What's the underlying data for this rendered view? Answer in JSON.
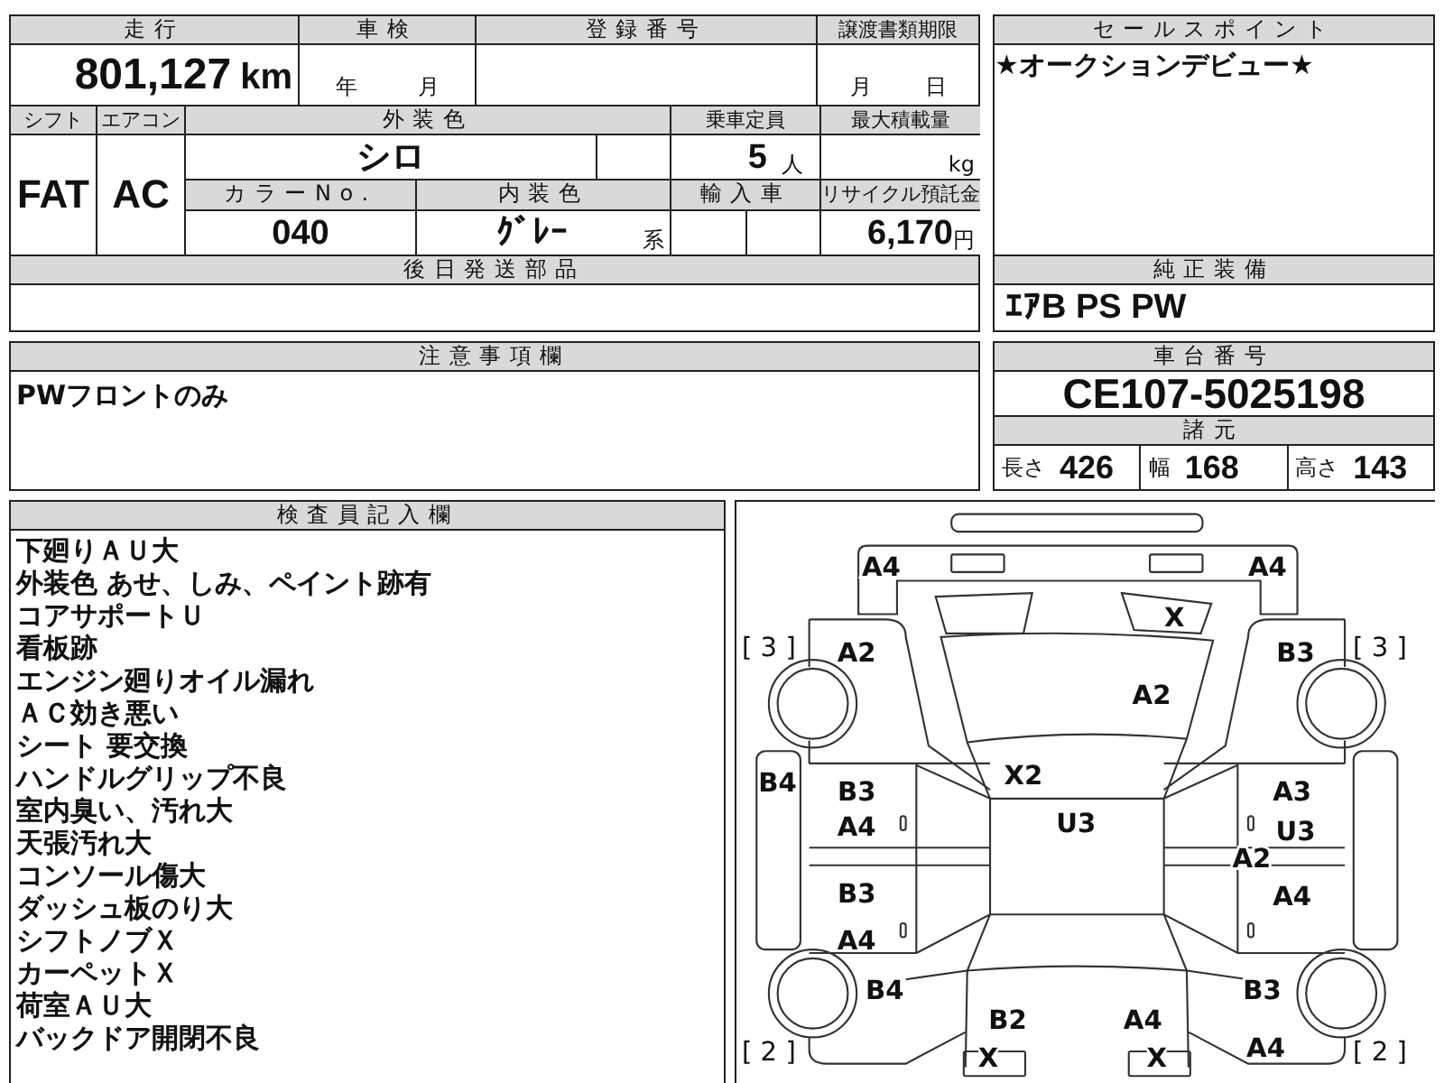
{
  "vehicle_table": {
    "mileage": {
      "header": "走行",
      "value": "801,127",
      "unit": "km"
    },
    "inspection": {
      "header": "車検",
      "year_unit": "年",
      "month_unit": "月"
    },
    "registration": {
      "header": "登録番号"
    },
    "transfer_deadline": {
      "header": "譲渡書類期限",
      "month_unit": "月",
      "day_unit": "日"
    },
    "shift": {
      "header": "シフト",
      "value": "FAT"
    },
    "aircon": {
      "header": "エアコン",
      "value": "AC"
    },
    "exterior_color": {
      "header": "外装色",
      "value": "シロ"
    },
    "capacity": {
      "header": "乗車定員",
      "value": "5",
      "unit": "人"
    },
    "max_load": {
      "header": "最大積載量",
      "unit": "kg"
    },
    "color_no": {
      "header": "カラーNo.",
      "value": "040"
    },
    "interior_color": {
      "header": "内装色",
      "value": "ｸﾞﾚｰ",
      "suffix": "系"
    },
    "imported": {
      "header": "輸入車"
    },
    "recycle_fee": {
      "header": "リサイクル預託金",
      "value": "6,170",
      "unit": "円"
    },
    "later_parts": {
      "header": "後日発送部品"
    }
  },
  "sales_point": {
    "header": "セールスポイント",
    "text": "★オークションデビュー★"
  },
  "standard_equipment": {
    "header": "純正装備",
    "text": "ｴｱB PS PW"
  },
  "notes": {
    "header": "注意事項欄",
    "text": "PWフロントのみ"
  },
  "chassis": {
    "header": "車台番号",
    "value": "CE107-5025198"
  },
  "specs": {
    "header": "諸元",
    "items": [
      {
        "label": "長さ",
        "value": "426"
      },
      {
        "label": "幅",
        "value": "168"
      },
      {
        "label": "高さ",
        "value": "143"
      }
    ]
  },
  "inspector_notes": {
    "header": "検査員記入欄",
    "lines": [
      "下廻りＡＵ大",
      "外装色 あせ、しみ、ペイント跡有",
      "コアサポートＵ",
      "看板跡",
      "エンジン廻りオイル漏れ",
      "ＡＣ効き悪い",
      "シート 要交換",
      "ハンドルグリップ不良",
      "室内臭い、汚れ大",
      "天張汚れ大",
      "コンソール傷大",
      "ダッシュ板のり大",
      "シフトノブＸ",
      "カーペットＸ",
      "荷室ＡＵ大",
      "バックドア開閉不良"
    ]
  },
  "damage_map": {
    "marks": [
      {
        "code": "A4"
      },
      {
        "code": "A4"
      },
      {
        "code": "A2"
      },
      {
        "code": "X"
      },
      {
        "code": "B3"
      },
      {
        "code": "A2"
      },
      {
        "code": "B4"
      },
      {
        "code": "X2"
      },
      {
        "code": "B3"
      },
      {
        "code": "A4"
      },
      {
        "code": "U3"
      },
      {
        "code": "A3"
      },
      {
        "code": "U3"
      },
      {
        "code": "A2"
      },
      {
        "code": "B3"
      },
      {
        "code": "A4"
      },
      {
        "code": "A4"
      },
      {
        "code": "B4"
      },
      {
        "code": "B3"
      },
      {
        "code": "B2"
      },
      {
        "code": "A4"
      },
      {
        "code": "A4"
      },
      {
        "code": "X"
      },
      {
        "code": "X"
      }
    ],
    "tread": [
      {
        "value": "[ 3 ]"
      },
      {
        "value": "[ 3 ]"
      },
      {
        "value": "[ 2 ]"
      },
      {
        "value": "[ 2 ]"
      }
    ]
  }
}
